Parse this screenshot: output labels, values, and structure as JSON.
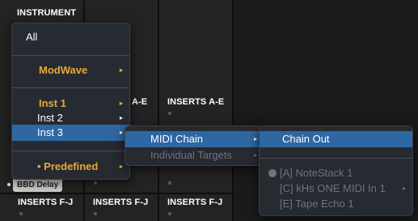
{
  "background": {
    "headers": {
      "instrument": "INSTRUMENT",
      "inserts_ae_partial": "A-E",
      "inserts_ae": "INSERTS A-E",
      "inserts_fj": [
        "INSERTS F-J",
        "INSERTS F-J",
        "INSERTS F-J"
      ]
    },
    "badge": "BBD Delay"
  },
  "menu1": {
    "items": [
      {
        "label": "All"
      },
      {
        "label": "ModWave",
        "arrow": "▸"
      },
      {
        "label": "Inst 1",
        "arrow": "▸"
      },
      {
        "label": "Inst 2",
        "arrow": "▸"
      },
      {
        "label": "Inst 3",
        "arrow": "▸"
      },
      {
        "label": "• Predefined",
        "arrow": "▸"
      }
    ]
  },
  "menu2": {
    "items": [
      {
        "label": "MIDI Chain",
        "arrow": "▸"
      },
      {
        "label": "Individual Targets",
        "arrow": "▸"
      }
    ]
  },
  "menu3": {
    "items": [
      {
        "label": "Chain Out"
      },
      {
        "label": "[A] NoteStack 1"
      },
      {
        "label": "[C] kHs ONE MIDI In 1",
        "arrow": "▸"
      },
      {
        "label": "[E] Tape Echo 1"
      }
    ]
  },
  "colors": {
    "highlight": "#2f67a3",
    "gold": "#e6a93a",
    "menu_bg": "#262a31",
    "panel_bg": "#232323"
  }
}
